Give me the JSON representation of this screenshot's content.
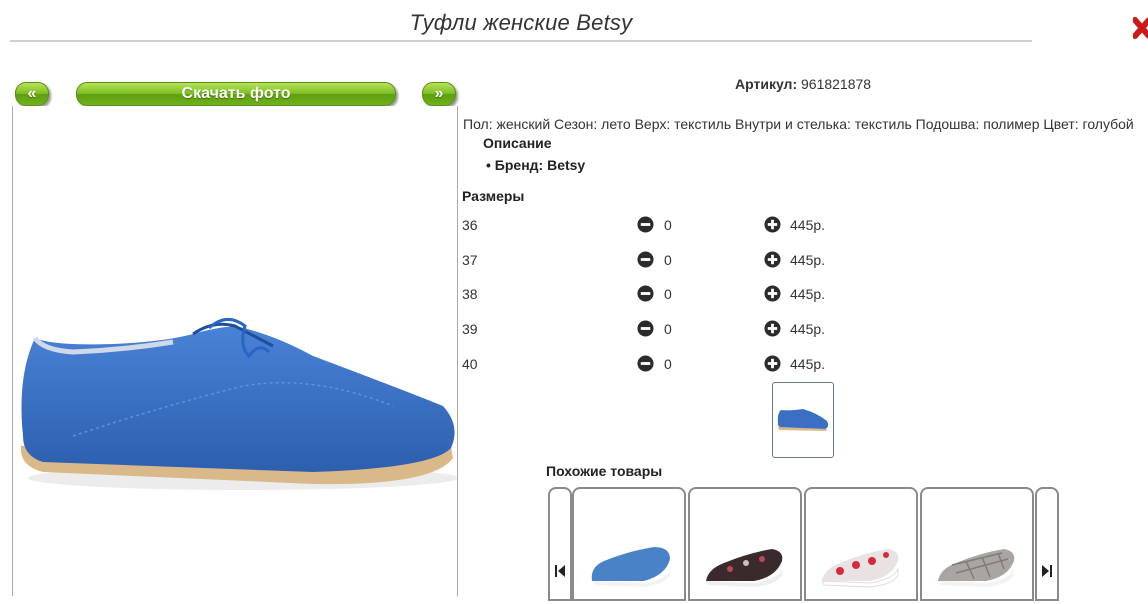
{
  "product": {
    "title": "Туфли женские Betsy",
    "article_label": "Артикул:",
    "article_value": "961821878",
    "properties_line": "Пол: женский Сезон: лето Верх: текстиль Внутри и стелька: текстиль Подошва: полимер Цвет: голубой",
    "description_heading": "Описание",
    "brand_line": "Бренд: Betsy",
    "color_accent": "#3a6fc4"
  },
  "photo_controls": {
    "prev_label": "«",
    "download_label": "Скачать фото",
    "next_label": "»"
  },
  "sizes": {
    "heading": "Размеры",
    "rows": [
      {
        "size": "36",
        "qty": "0",
        "price": "445р."
      },
      {
        "size": "37",
        "qty": "0",
        "price": "445р."
      },
      {
        "size": "38",
        "qty": "0",
        "price": "445р."
      },
      {
        "size": "39",
        "qty": "0",
        "price": "445р."
      },
      {
        "size": "40",
        "qty": "0",
        "price": "445р."
      }
    ]
  },
  "similar": {
    "heading": "Похожие товары",
    "items": [
      "blue-slip-on-shoe",
      "floral-dark-slip-on-shoe",
      "red-floral-slip-on-shoe",
      "grey-checkered-slip-on-shoe"
    ]
  },
  "icons": {
    "close": "close-icon",
    "minus": "minus-circle-icon",
    "plus": "plus-circle-icon",
    "carousel_prev": "skip-previous-icon",
    "carousel_next": "skip-next-icon"
  }
}
